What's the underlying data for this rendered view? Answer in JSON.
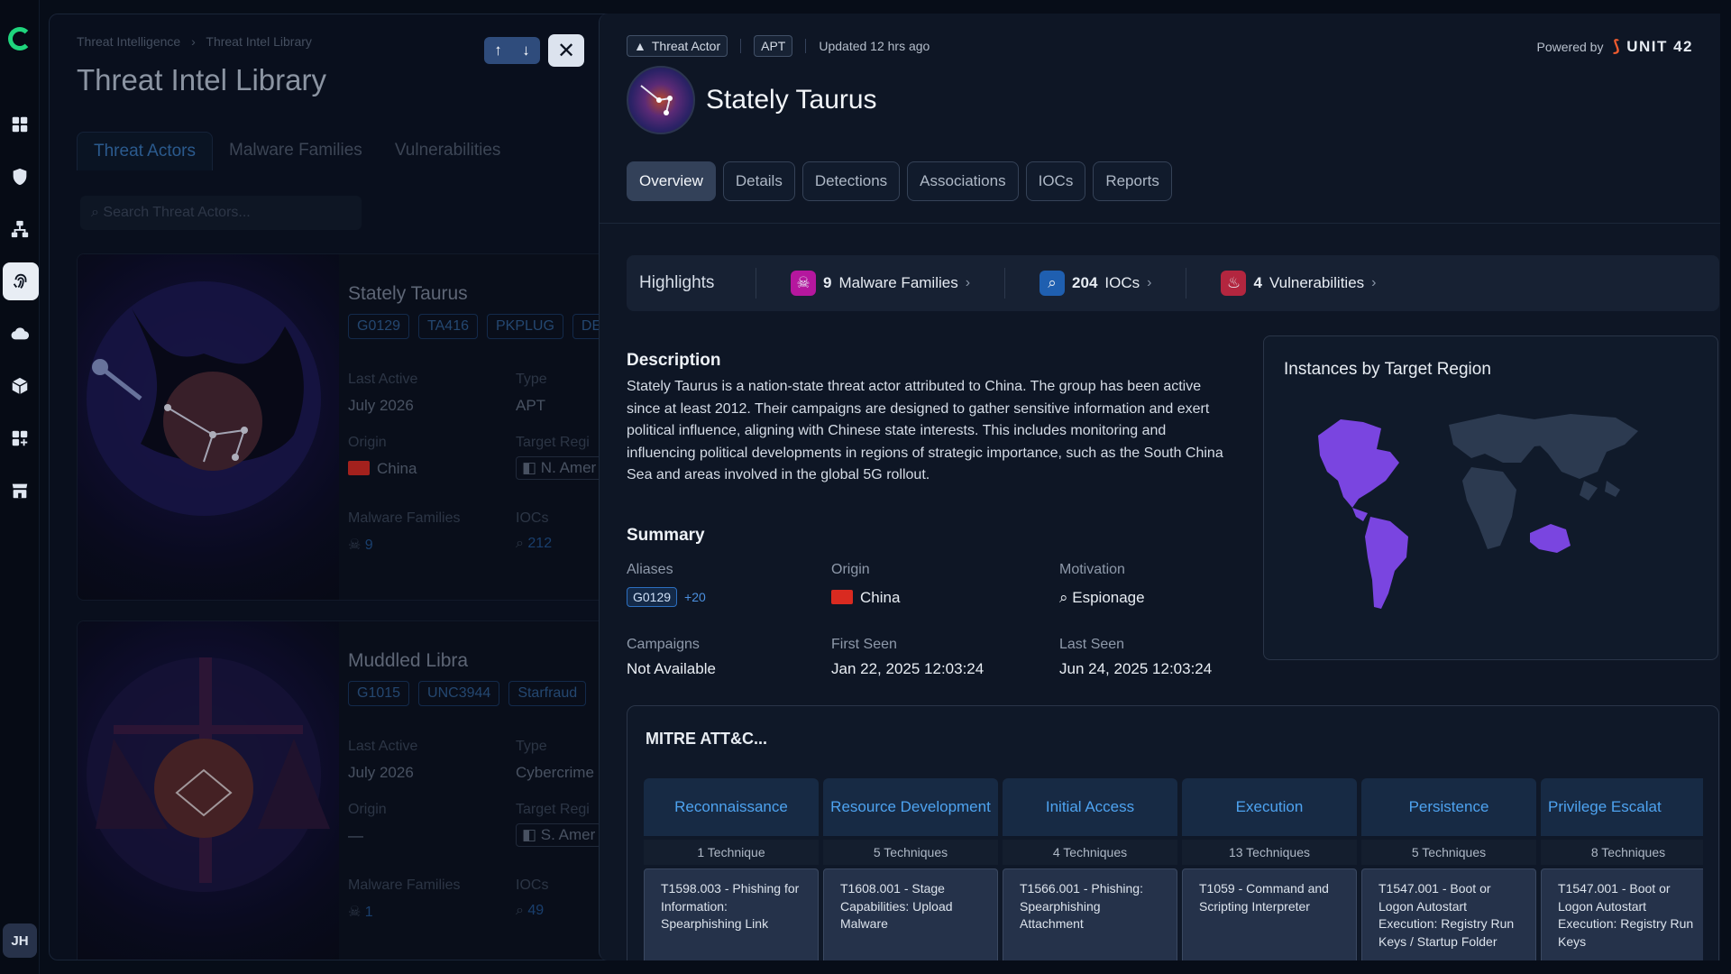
{
  "rail": {
    "avatar": "JH"
  },
  "library": {
    "breadcrumb": [
      "Threat Intelligence",
      "Threat Intel Library"
    ],
    "title": "Threat Intel Library",
    "tabs": [
      "Threat Actors",
      "Malware Families",
      "Vulnerabilities"
    ],
    "search_placeholder": "Search Threat Actors...",
    "cards": [
      {
        "name": "Stately Taurus",
        "tags": [
          "G0129",
          "TA416",
          "PKPLUG",
          "DE"
        ],
        "last_active_label": "Last Active",
        "last_active": "July 2026",
        "type_label": "Type",
        "type": "APT",
        "origin_label": "Origin",
        "origin": "China",
        "target_label": "Target Regi",
        "target": "N. Amer",
        "malware_label": "Malware Families",
        "malware_count": "9",
        "iocs_label": "IOCs",
        "iocs_count": "212"
      },
      {
        "name": "Muddled Libra",
        "tags": [
          "G1015",
          "UNC3944",
          "Starfraud"
        ],
        "last_active_label": "Last Active",
        "last_active": "July 2026",
        "type_label": "Type",
        "type": "Cybercrime",
        "origin_label": "Origin",
        "origin": "—",
        "target_label": "Target Regi",
        "target": "S. Amer",
        "malware_label": "Malware Families",
        "malware_count": "1",
        "iocs_label": "IOCs",
        "iocs_count": "49"
      }
    ]
  },
  "detail": {
    "badge_type": "Threat Actor",
    "badge_kind": "APT",
    "updated": "Updated 12 hrs ago",
    "powered_by": "Powered by",
    "brand": "UNIT 42",
    "name": "Stately Taurus",
    "tabs": [
      "Overview",
      "Details",
      "Detections",
      "Associations",
      "IOCs",
      "Reports"
    ],
    "highlights": {
      "title": "Highlights",
      "items": [
        {
          "count": "9",
          "label": "Malware Families",
          "color": "#b5179e"
        },
        {
          "count": "204",
          "label": "IOCs",
          "color": "#1f5fb0"
        },
        {
          "count": "4",
          "label": "Vulnerabilities",
          "color": "#b3263f"
        }
      ]
    },
    "description_title": "Description",
    "description": "Stately Taurus is a nation-state threat actor attributed to China. The group has been active since at least 2012. Their campaigns are designed to gather sensitive information and exert political influence, aligning with Chinese state interests. This includes monitoring and influencing political developments in regions of strategic importance, such as the South China Sea and areas involved in the global 5G rollout.",
    "summary": {
      "title": "Summary",
      "aliases_label": "Aliases",
      "alias": "G0129",
      "alias_more": "+20",
      "origin_label": "Origin",
      "origin": "China",
      "motivation_label": "Motivation",
      "motivation": "Espionage",
      "campaigns_label": "Campaigns",
      "campaigns": "Not Available",
      "first_seen_label": "First Seen",
      "first_seen": "Jan 22, 2025 12:03:24",
      "last_seen_label": "Last Seen",
      "last_seen": "Jun 24, 2025 12:03:24"
    },
    "map": {
      "title": "Instances by Target Region",
      "highlight_color": "#7a45e0",
      "base_color": "#2c3a50"
    },
    "mitre": {
      "title": "MITRE ATT&C...",
      "tactics": [
        {
          "name": "Reconnaissance",
          "count": "1 Technique",
          "technique": "T1598.003 - Phishing for Information: Spearphishing Link"
        },
        {
          "name": "Resource Development",
          "count": "5 Techniques",
          "technique": "T1608.001 - Stage Capabilities: Upload Malware"
        },
        {
          "name": "Initial Access",
          "count": "4 Techniques",
          "technique": "T1566.001 - Phishing: Spearphishing Attachment"
        },
        {
          "name": "Execution",
          "count": "13 Techniques",
          "technique": "T1059 - Command and Scripting Interpreter"
        },
        {
          "name": "Persistence",
          "count": "5 Techniques",
          "technique": "T1547.001 - Boot or Logon Autostart Execution: Registry Run Keys / Startup Folder"
        },
        {
          "name": "Privilege Escalat",
          "count": "8 Techniques",
          "technique": "T1547.001 - Boot or Logon Autostart Execution: Registry Run Keys"
        }
      ]
    }
  }
}
